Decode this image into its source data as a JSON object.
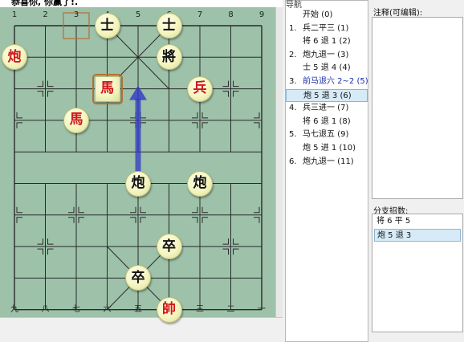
{
  "status": {
    "title": "恭喜你, 你赢了!."
  },
  "board": {
    "top_coords": [
      "1",
      "2",
      "3",
      "4",
      "5",
      "6",
      "7",
      "8",
      "9"
    ],
    "bottom_coords": [
      "九",
      "八",
      "七",
      "六",
      "五",
      "四",
      "三",
      "二",
      "一"
    ],
    "pieces": [
      {
        "name": "piece-red-cannon-a",
        "char": "炮",
        "side": "red"
      },
      {
        "name": "piece-black-advisor-a",
        "char": "士",
        "side": "black"
      },
      {
        "name": "piece-black-advisor-b",
        "char": "士",
        "side": "black"
      },
      {
        "name": "piece-black-general",
        "char": "將",
        "side": "black"
      },
      {
        "name": "piece-red-horse-selected",
        "char": "馬",
        "side": "red",
        "selected": true
      },
      {
        "name": "piece-red-soldier",
        "char": "兵",
        "side": "red"
      },
      {
        "name": "piece-red-horse",
        "char": "馬",
        "side": "red"
      },
      {
        "name": "piece-black-cannon-a",
        "char": "炮",
        "side": "black"
      },
      {
        "name": "piece-black-cannon-b",
        "char": "炮",
        "side": "black"
      },
      {
        "name": "piece-black-pawn-a",
        "char": "卒",
        "side": "black"
      },
      {
        "name": "piece-black-pawn-b",
        "char": "卒",
        "side": "black"
      },
      {
        "name": "piece-red-king",
        "char": "帥",
        "side": "red"
      }
    ]
  },
  "navigation": {
    "header": "导航",
    "moves": [
      {
        "num": "",
        "text": "开始 (0)"
      },
      {
        "num": "1.",
        "text": "兵二平三 (1)"
      },
      {
        "num": "",
        "text": "将 6 退 1 (2)"
      },
      {
        "num": "2.",
        "text": "炮九退一 (3)"
      },
      {
        "num": "",
        "text": "士 5 退 4 (4)"
      },
      {
        "num": "3.",
        "text": "前马退六 2~2 (5)",
        "current": true
      },
      {
        "num": "",
        "text": "炮 5 退 3 (6)",
        "selected": true
      },
      {
        "num": "4.",
        "text": "兵三进一 (7)"
      },
      {
        "num": "",
        "text": "将 6 退 1 (8)"
      },
      {
        "num": "5.",
        "text": "马七退五 (9)"
      },
      {
        "num": "",
        "text": "炮 5 进 1 (10)"
      },
      {
        "num": "6.",
        "text": "炮九退一 (11)"
      }
    ]
  },
  "notes": {
    "label": "注释(可编辑):"
  },
  "branches": {
    "label": "分支招数:",
    "items": [
      {
        "text": "将 6 平 5"
      },
      {
        "text": "炮 5 退 3",
        "selected": true
      }
    ]
  },
  "colors": {
    "board": "#9dc1a9",
    "line": "#2a2a2a",
    "red_piece": "#d01818",
    "arrow": "#3038c8",
    "highlight": "#b46e3a",
    "selection": "#d6ebf7"
  }
}
